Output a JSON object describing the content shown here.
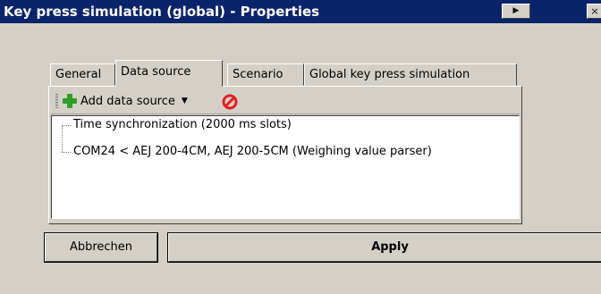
{
  "window": {
    "title": "Key press simulation (global) - Properties",
    "menu_glyph": "▶",
    "close_glyph": "×"
  },
  "tabs": [
    {
      "label": "General",
      "active": false
    },
    {
      "label": "Data source",
      "active": true
    },
    {
      "label": "Scenario",
      "active": false
    },
    {
      "label": "Global key press simulation",
      "active": false
    }
  ],
  "toolbar": {
    "add_label": "Add data source",
    "add_caret": "▼",
    "add_icon": "plus-icon",
    "remove_icon": "no-entry-icon"
  },
  "data_sources": [
    "Time synchronization (2000 ms slots)",
    "COM24 < AEJ 200-4CM, AEJ 200-5CM (Weighing value parser)"
  ],
  "buttons": {
    "cancel": "Abbrechen",
    "apply": "Apply"
  },
  "colors": {
    "titlebar": "#0a246a",
    "face": "#d4d0c8",
    "add_icon": "#2f9e26",
    "remove_icon": "#e02020"
  }
}
